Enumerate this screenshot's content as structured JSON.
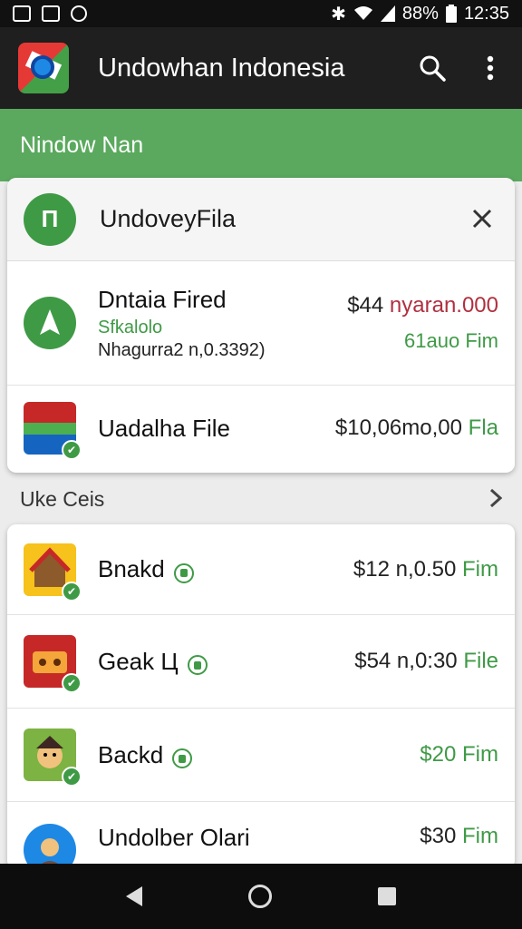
{
  "status": {
    "battery": "88%",
    "time": "12:35"
  },
  "appbar": {
    "title": "Undowhan Indonesia"
  },
  "banner": {
    "text": "Nindow Nan"
  },
  "top_card": {
    "header_badge": "П",
    "header_title": "UndoveyFila",
    "rows": [
      {
        "name": "Dntaia Fired",
        "sub1": "Sfkalolo",
        "sub2": "Nhagurra2 n,0.3392)",
        "price_main": "$44",
        "price_accent": "nyaran.000",
        "price2": "61auo Fim"
      },
      {
        "name": "Uadalha File",
        "price_main": "$10,06mo,00",
        "price_accent": "Fla"
      }
    ]
  },
  "section": {
    "label": "Uke Ceis"
  },
  "list": [
    {
      "name": "Bnakd",
      "price": "$12 n,0.50",
      "unit": "Fim"
    },
    {
      "name": "Geak Ц",
      "price": "$54 n,0:30",
      "unit": "File"
    },
    {
      "name": "Backd",
      "price": "$20",
      "unit": "Fim"
    },
    {
      "name": "Undolber Olari",
      "price": "$30",
      "unit": "Fim"
    }
  ]
}
